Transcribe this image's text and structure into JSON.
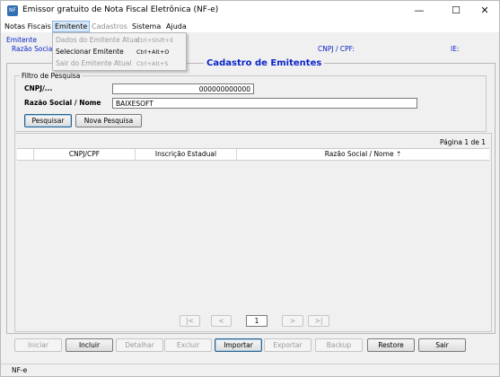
{
  "window": {
    "title": "Emissor gratuito de Nota Fiscal Eletrônica (NF-e)",
    "app_icon_text": "NF",
    "controls": {
      "minimize": "—",
      "maximize": "☐",
      "close": "✕"
    }
  },
  "menubar": {
    "items": [
      {
        "label": "Notas Fiscais",
        "state": "normal"
      },
      {
        "label": "Emitente",
        "state": "open"
      },
      {
        "label": "Cadastros",
        "state": "disabled"
      },
      {
        "label": "Sistema",
        "state": "normal"
      },
      {
        "label": "Ajuda",
        "state": "normal"
      }
    ]
  },
  "emitente_dropdown": {
    "items": [
      {
        "label": "Dados do Emitente Atual",
        "shortcut": "Ctrl+Shift+E",
        "enabled": false
      },
      {
        "label": "Selecionar Emitente",
        "shortcut": "Ctrl+Alt+O",
        "enabled": true
      },
      {
        "label": "Sair do Emitente Atual",
        "shortcut": "Ctrl+Alt+S",
        "enabled": false
      }
    ]
  },
  "infobar": {
    "section_label": "Emitente",
    "razao_social_label": "Razão Social",
    "cnpj_label": "CNPJ / CPF:",
    "ie_label": "IE:"
  },
  "cadastro": {
    "title": "Cadastro de Emitentes",
    "filter": {
      "legend": "Filtro de Pesquisa",
      "cnpj_label": "CNPJ/...",
      "cnpj_value": "000000000000",
      "razao_label": "Razão Social / Nome",
      "razao_value": "BAIXESOFT",
      "search_button": "Pesquisar",
      "new_search_button": "Nova Pesquisa"
    },
    "results": {
      "page_info": "Página 1 de 1",
      "columns": [
        "CNPJ/CPF",
        "Inscrição Estadual",
        "Razão Social / Nome ⇡"
      ],
      "rows": []
    },
    "pager": {
      "first": "|<",
      "prev": "<",
      "page": "1",
      "next": ">",
      "last": ">|"
    }
  },
  "actions": {
    "buttons": [
      {
        "label": "Iniciar",
        "enabled": false
      },
      {
        "label": "Incluir",
        "enabled": true
      },
      {
        "label": "Detalhar",
        "enabled": false
      },
      {
        "label": "Excluir",
        "enabled": false
      },
      {
        "label": "Importar",
        "enabled": true
      },
      {
        "label": "Exportar",
        "enabled": false
      },
      {
        "label": "Backup",
        "enabled": false
      },
      {
        "label": "Restore",
        "enabled": true
      },
      {
        "label": "Sair",
        "enabled": true
      }
    ]
  },
  "statusbar": {
    "text": "NF-e"
  }
}
